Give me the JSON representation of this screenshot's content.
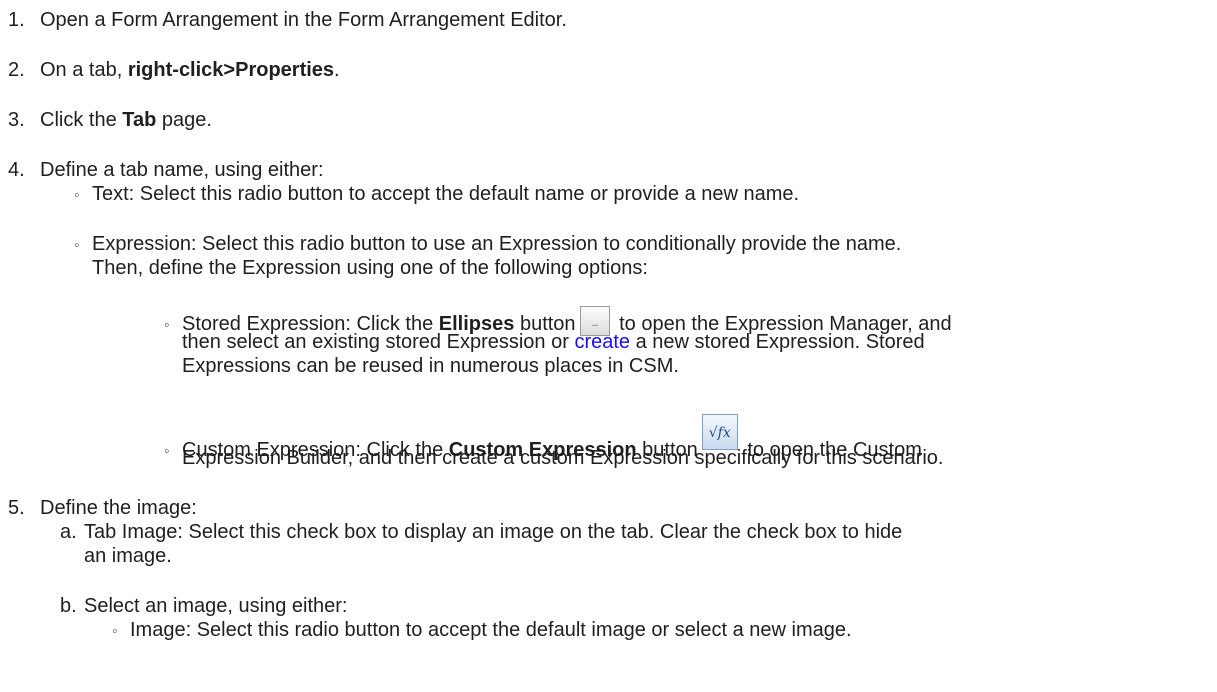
{
  "steps": {
    "s1": {
      "num": "1.",
      "text": "Open a Form Arrangement in the Form Arrangement Editor."
    },
    "s2": {
      "num": "2.",
      "pre": "On a tab, ",
      "bold": "right-click>Properties",
      "post": "."
    },
    "s3": {
      "num": "3.",
      "pre": "Click the ",
      "bold": "Tab",
      "post": " page."
    },
    "s4": {
      "num": "4.",
      "text": "Define a tab name, using either:",
      "text_option": "Text: Select this radio button to accept the default name or provide a new name.",
      "expr_option_l1": "Expression: Select this radio button to use an Expression to conditionally provide the name.",
      "expr_option_l2": "Then, define the Expression using one of the following options:",
      "stored": {
        "pre": "Stored Expression: Click the ",
        "bold": "Ellipses",
        "mid": " button",
        "post": " to open the Expression Manager, and",
        "l2_pre": "then select an existing stored Expression or ",
        "link": "create",
        "l2_post": " a new stored Expression. Stored",
        "l3": "Expressions can be reused in numerous places in CSM.",
        "button_glyph": "..."
      },
      "custom": {
        "pre": "Custom Expression: Click the ",
        "bold": "Custom Expression",
        "mid": " button",
        "post": " to open the Custom",
        "l2": "Expression Builder, and then create a custom Expression specifically for this scenario.",
        "button_glyph": "√fx"
      }
    },
    "s5": {
      "num": "5.",
      "text": "Define the image:",
      "a_label": "a.",
      "a_l1": "Tab Image: Select this check box to display an image on the tab. Clear the check box to hide",
      "a_l2": "an image.",
      "b_label": "b.",
      "b_text": "Select an image, using either:",
      "image_option": "Image: Select this radio button to accept the default image or select a new image."
    }
  },
  "bullet_glyph": "◦",
  "icons": {
    "ellipses": "ellipsis-button-icon",
    "custom_expression": "fx-function-icon"
  },
  "colors": {
    "text": "#1f1f1f",
    "link": "#1a0dff"
  }
}
